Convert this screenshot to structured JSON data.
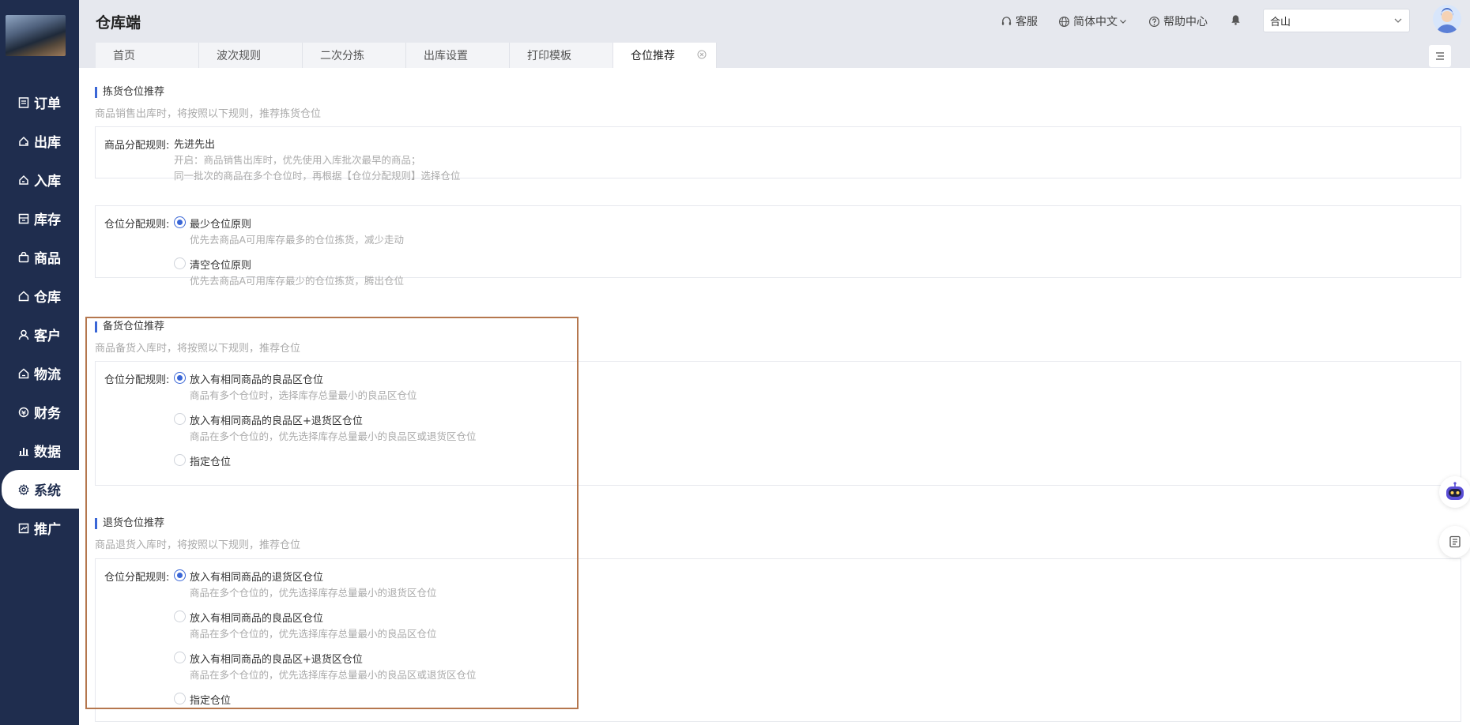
{
  "sidebar": {
    "items": [
      {
        "label": "订单",
        "icon": "order-icon"
      },
      {
        "label": "出库",
        "icon": "outbound-icon"
      },
      {
        "label": "入库",
        "icon": "inbound-icon"
      },
      {
        "label": "库存",
        "icon": "inventory-icon"
      },
      {
        "label": "商品",
        "icon": "bag-icon"
      },
      {
        "label": "仓库",
        "icon": "warehouse-icon"
      },
      {
        "label": "客户",
        "icon": "user-icon"
      },
      {
        "label": "物流",
        "icon": "logistics-icon"
      },
      {
        "label": "财务",
        "icon": "finance-icon"
      },
      {
        "label": "数据",
        "icon": "chart-icon"
      },
      {
        "label": "系统",
        "icon": "gear-icon"
      },
      {
        "label": "推广",
        "icon": "promo-icon"
      }
    ],
    "active_index": 10
  },
  "header": {
    "title": "仓库端",
    "service": "客服",
    "language": "简体中文",
    "help": "帮助中心",
    "warehouse_value": "合山"
  },
  "tabs": [
    {
      "label": "首页"
    },
    {
      "label": "波次规则"
    },
    {
      "label": "二次分拣"
    },
    {
      "label": "出库设置"
    },
    {
      "label": "打印模板"
    },
    {
      "label": "仓位推荐"
    }
  ],
  "sections": {
    "picking": {
      "title": "拣货仓位推荐",
      "desc": "商品销售出库时，将按照以下规则，推荐拣货仓位",
      "product_rule_label": "商品分配规则:",
      "product_rule_value": "先进先出",
      "product_rule_desc1": "开启：商品销售出库时，优先使用入库批次最早的商品；",
      "product_rule_desc2": "同一批次的商品在多个仓位时，再根据【仓位分配规则】选择仓位",
      "location_rule_label": "仓位分配规则:",
      "options": [
        {
          "title": "最少仓位原则",
          "desc": "优先去商品A可用库存最多的仓位拣货，减少走动"
        },
        {
          "title": "清空仓位原则",
          "desc": "优先去商品A可用库存最少的仓位拣货，腾出仓位"
        }
      ]
    },
    "stocking": {
      "title": "备货仓位推荐",
      "desc": "商品备货入库时，将按照以下规则，推荐仓位",
      "location_rule_label": "仓位分配规则:",
      "options": [
        {
          "title": "放入有相同商品的良品区仓位",
          "desc": "商品有多个仓位时，选择库存总量最小的良品区仓位"
        },
        {
          "title": "放入有相同商品的良品区+退货区仓位",
          "desc": "商品在多个仓位的，优先选择库存总量最小的良品区或退货区仓位"
        },
        {
          "title": "指定仓位",
          "desc": ""
        }
      ]
    },
    "returns": {
      "title": "退货仓位推荐",
      "desc": "商品退货入库时，将按照以下规则，推荐仓位",
      "location_rule_label": "仓位分配规则:",
      "options": [
        {
          "title": "放入有相同商品的退货区仓位",
          "desc": "商品在多个仓位的，优先选择库存总量最小的退货区仓位"
        },
        {
          "title": "放入有相同商品的良品区仓位",
          "desc": "商品在多个仓位的，优先选择库存总量最小的良品区仓位"
        },
        {
          "title": "放入有相同商品的良品区+退货区仓位",
          "desc": "商品在多个仓位的，优先选择库存总量最小的良品区或退货区仓位"
        },
        {
          "title": "指定仓位",
          "desc": ""
        }
      ]
    }
  },
  "colors": {
    "sidebar": "#1f2d4e",
    "accent": "#3a66d6",
    "highlight": "#b5774e"
  }
}
